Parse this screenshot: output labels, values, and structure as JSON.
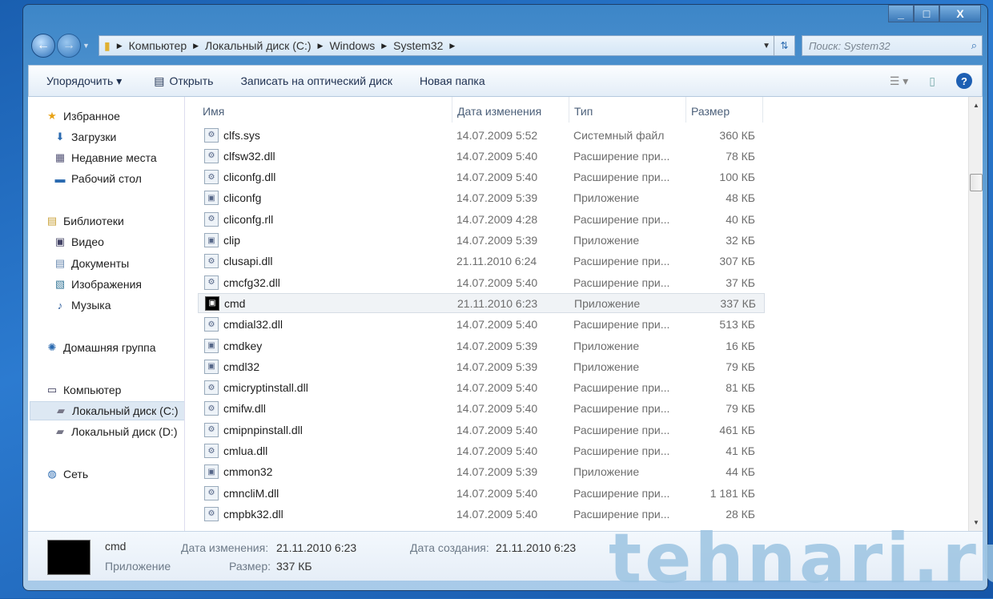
{
  "address": {
    "parts": [
      "Компьютер",
      "Локальный диск (C:)",
      "Windows",
      "System32"
    ]
  },
  "search": {
    "placeholder": "Поиск: System32"
  },
  "toolbar": {
    "organize": "Упорядочить ▾",
    "open": "Открыть",
    "burn": "Записать на оптический диск",
    "new_folder": "Новая папка"
  },
  "sidebar": {
    "items": [
      {
        "label": "Избранное",
        "icon": "star-icon",
        "glyph": "★",
        "color": "#e8a317"
      },
      {
        "label": "Загрузки",
        "icon": "downloads-icon",
        "glyph": "⬇",
        "color": "#2a6ab0"
      },
      {
        "label": "Недавние места",
        "icon": "recent-places-icon",
        "glyph": "▦",
        "color": "#557"
      },
      {
        "label": "Рабочий стол",
        "icon": "desktop-icon",
        "glyph": "▬",
        "color": "#2a6ab0"
      },
      {
        "label": "Библиотеки",
        "icon": "libraries-icon",
        "glyph": "▤",
        "color": "#c9a23a"
      },
      {
        "label": "Видео",
        "icon": "video-icon",
        "glyph": "▣",
        "color": "#446"
      },
      {
        "label": "Документы",
        "icon": "documents-icon",
        "glyph": "▤",
        "color": "#6a8ab0"
      },
      {
        "label": "Изображения",
        "icon": "pictures-icon",
        "glyph": "▧",
        "color": "#3a7a9a"
      },
      {
        "label": "Музыка",
        "icon": "music-icon",
        "glyph": "♪",
        "color": "#2a5a9a"
      },
      {
        "label": "Домашняя группа",
        "icon": "homegroup-icon",
        "glyph": "✺",
        "color": "#2a6ab0"
      },
      {
        "label": "Компьютер",
        "icon": "computer-icon",
        "glyph": "▭",
        "color": "#335"
      },
      {
        "label": "Локальный диск (C:)",
        "icon": "drive-icon",
        "glyph": "▰",
        "color": "#778"
      },
      {
        "label": "Локальный диск (D:)",
        "icon": "drive-icon",
        "glyph": "▰",
        "color": "#778"
      },
      {
        "label": "Сеть",
        "icon": "network-icon",
        "glyph": "◍",
        "color": "#2a6ab0"
      }
    ]
  },
  "columns": {
    "name": "Имя",
    "date": "Дата изменения",
    "type": "Тип",
    "size": "Размер"
  },
  "files": [
    {
      "name": "clfs.sys",
      "date": "14.07.2009 5:52",
      "type": "Системный файл",
      "size": "360 КБ"
    },
    {
      "name": "clfsw32.dll",
      "date": "14.07.2009 5:40",
      "type": "Расширение при...",
      "size": "78 КБ"
    },
    {
      "name": "cliconfg.dll",
      "date": "14.07.2009 5:40",
      "type": "Расширение при...",
      "size": "100 КБ"
    },
    {
      "name": "cliconfg",
      "date": "14.07.2009 5:39",
      "type": "Приложение",
      "size": "48 КБ"
    },
    {
      "name": "cliconfg.rll",
      "date": "14.07.2009 4:28",
      "type": "Расширение при...",
      "size": "40 КБ"
    },
    {
      "name": "clip",
      "date": "14.07.2009 5:39",
      "type": "Приложение",
      "size": "32 КБ"
    },
    {
      "name": "clusapi.dll",
      "date": "21.11.2010 6:24",
      "type": "Расширение при...",
      "size": "307 КБ"
    },
    {
      "name": "cmcfg32.dll",
      "date": "14.07.2009 5:40",
      "type": "Расширение при...",
      "size": "37 КБ"
    },
    {
      "name": "cmd",
      "date": "21.11.2010 6:23",
      "type": "Приложение",
      "size": "337 КБ"
    },
    {
      "name": "cmdial32.dll",
      "date": "14.07.2009 5:40",
      "type": "Расширение при...",
      "size": "513 КБ"
    },
    {
      "name": "cmdkey",
      "date": "14.07.2009 5:39",
      "type": "Приложение",
      "size": "16 КБ"
    },
    {
      "name": "cmdl32",
      "date": "14.07.2009 5:39",
      "type": "Приложение",
      "size": "79 КБ"
    },
    {
      "name": "cmicryptinstall.dll",
      "date": "14.07.2009 5:40",
      "type": "Расширение при...",
      "size": "81 КБ"
    },
    {
      "name": "cmifw.dll",
      "date": "14.07.2009 5:40",
      "type": "Расширение при...",
      "size": "79 КБ"
    },
    {
      "name": "cmipnpinstall.dll",
      "date": "14.07.2009 5:40",
      "type": "Расширение при...",
      "size": "461 КБ"
    },
    {
      "name": "cmlua.dll",
      "date": "14.07.2009 5:40",
      "type": "Расширение при...",
      "size": "41 КБ"
    },
    {
      "name": "cmmon32",
      "date": "14.07.2009 5:39",
      "type": "Приложение",
      "size": "44 КБ"
    },
    {
      "name": "cmncliM.dll",
      "date": "14.07.2009 5:40",
      "type": "Расширение при...",
      "size": "1 181 КБ"
    },
    {
      "name": "cmpbk32.dll",
      "date": "14.07.2009 5:40",
      "type": "Расширение при...",
      "size": "28 КБ"
    }
  ],
  "details": {
    "name": "cmd",
    "type": "Приложение",
    "modified_label": "Дата изменения:",
    "modified": "21.11.2010 6:23",
    "created_label": "Дата создания:",
    "created": "21.11.2010 6:23",
    "size_label": "Размер:",
    "size": "337 КБ"
  },
  "watermark": "tehnari.ru"
}
